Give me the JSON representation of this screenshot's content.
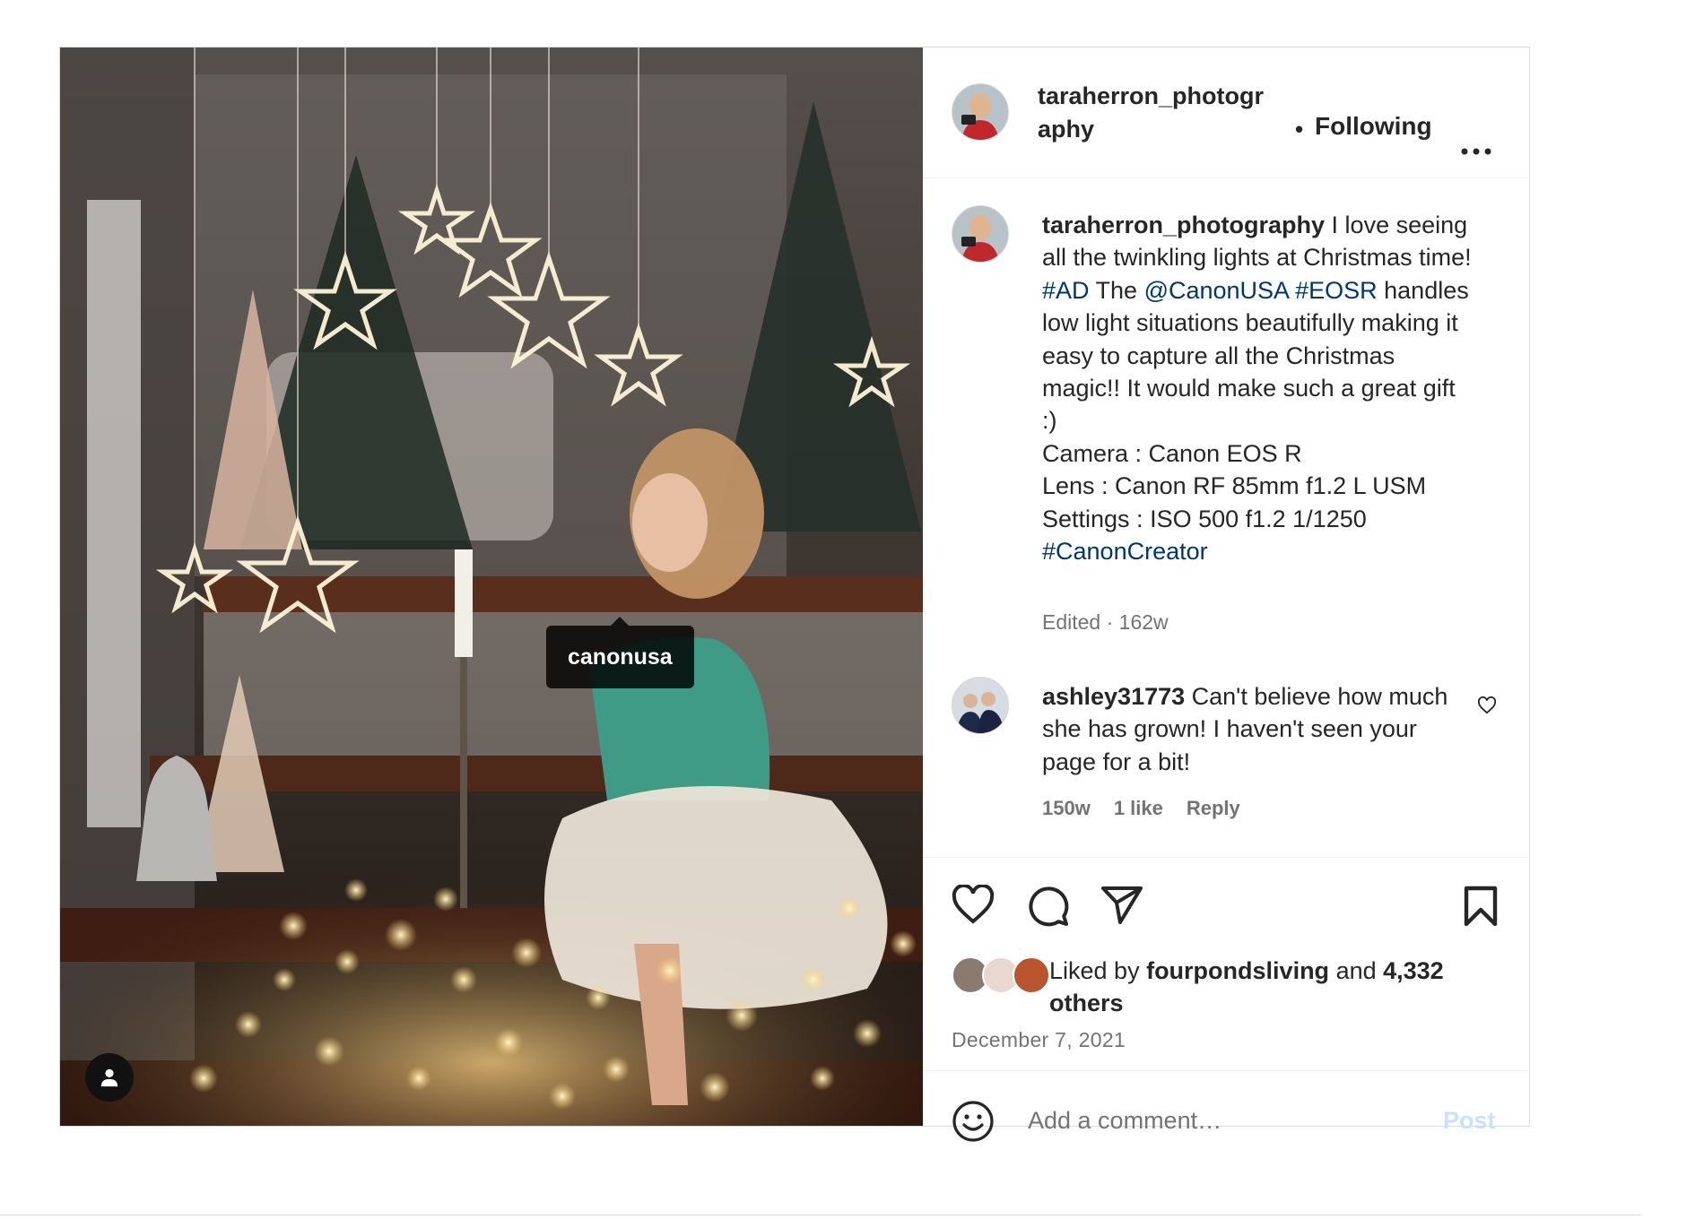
{
  "photo": {
    "tag_label": "canonusa"
  },
  "header": {
    "username_line1": "taraherron_photogr",
    "username_line2": "aphy",
    "dot": "•",
    "follow_label": "Following"
  },
  "caption": {
    "username": "taraherron_photography",
    "text_1": " I love seeing all the twinkling lights at Christmas time! ",
    "hashtag_ad": "#AD",
    "text_2": " The ",
    "mention_canon": "@CanonUSA",
    "text_3": " ",
    "hashtag_eosr": "#EOSR",
    "text_4": " handles low light situations beautifully making it easy to capture all the Christmas magic!! It would make such a great gift :)",
    "camera": "Camera : Canon EOS R",
    "lens": "Lens : Canon RF 85mm f1.2 L USM",
    "settings": "Settings : ISO 500 f1.2 1/1250",
    "hashtag_creator": "#CanonCreator",
    "meta": "Edited · 162w"
  },
  "comment": {
    "username": "ashley31773",
    "text": " Can't believe how much she has grown! I haven't seen your page for a bit!",
    "age": "150w",
    "likes": "1 like",
    "reply": "Reply"
  },
  "likes": {
    "prefix": "Liked by ",
    "user": "fourpondsliving",
    "middle": " and ",
    "count": "4,332 others"
  },
  "date": "December 7, 2021",
  "add_comment": {
    "placeholder": "Add a comment…",
    "post_label": "Post"
  },
  "colors": {
    "link": "#00376b",
    "muted": "#737373",
    "post_disabled": "#c6e3fb",
    "border": "#dbdbdb"
  }
}
